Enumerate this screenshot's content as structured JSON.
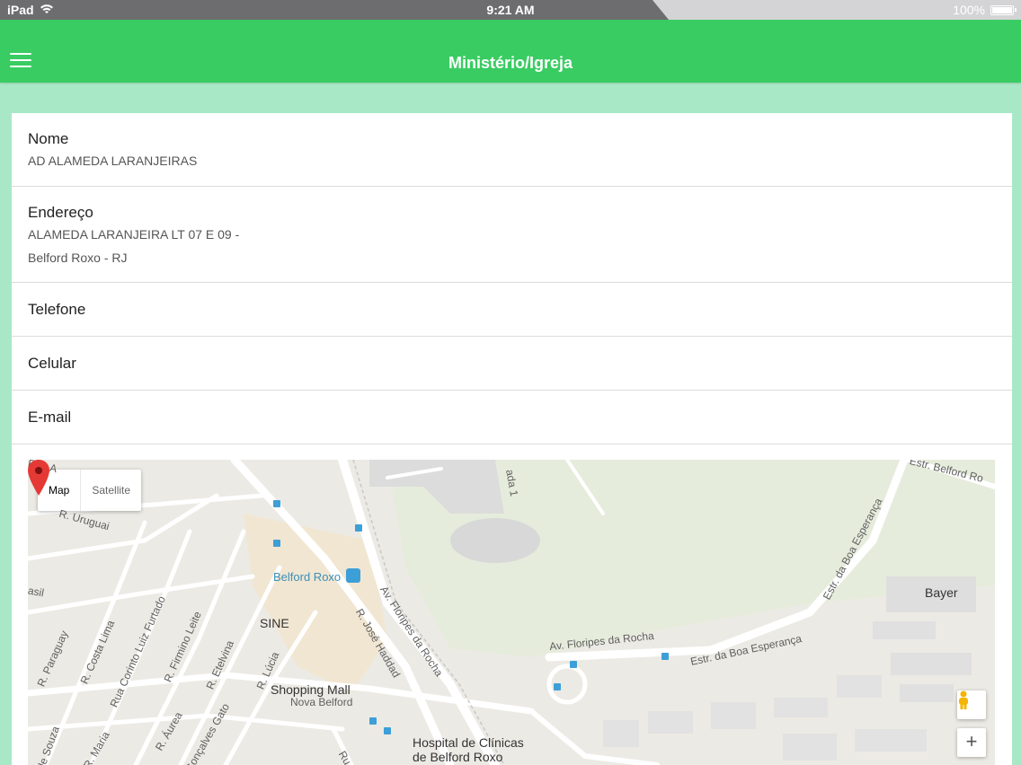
{
  "status_bar": {
    "device": "iPad",
    "time": "9:21 AM",
    "battery": "100%"
  },
  "header": {
    "title": "Ministério/Igreja",
    "menu_icon": "hamburger-menu-icon"
  },
  "fields": {
    "nome": {
      "label": "Nome",
      "value": "AD ALAMEDA LARANJEIRAS"
    },
    "endereco": {
      "label": "Endereço",
      "line1": "ALAMEDA LARANJEIRA LT 07 E 09 -",
      "line2": "Belford Roxo - RJ"
    },
    "telefone": {
      "label": "Telefone"
    },
    "celular": {
      "label": "Celular"
    },
    "email": {
      "label": "E-mail"
    }
  },
  "map": {
    "type_buttons": {
      "map": "Map",
      "satellite": "Satellite"
    },
    "zoom_in": "+",
    "labels": {
      "belford_roxo": "Belford Roxo",
      "sine": "SINE",
      "shopping_mall": "Shopping Mall",
      "nova_belford": "Nova Belford",
      "hospital_1": "Hospital de Clínicas",
      "hospital_2": "de Belford Roxo",
      "bayer": "Bayer",
      "av_floripes_1": "Av. Floripes da Rocha",
      "av_floripes_2": "Av. Floripes da Rocha",
      "r_jose_haddad": "R. José Haddad",
      "estr_boa_esperanca_1": "Estr. da Boa Esperança",
      "estr_boa_esperanca_2": "Estr. da Boa Esperança",
      "estr_belford_roxo": "Estr. Belford Ro",
      "r_uruguai": "R. Uruguai",
      "r_paraguay": "R. Paraguay",
      "r_costa_lima": "R. Costa Lima",
      "r_corinto": "Rua Corinto Luiz Furtado",
      "r_firmino": "R. Firmino Leite",
      "r_etelvina": "R. Etelvina",
      "r_lucia": "R. Lúcia",
      "r_aurea": "R. Áurea",
      "r_maria": "R. Maria",
      "goncalves_gato": "Gonçalves Gato",
      "de_souza": "de Souza",
      "brasil": "asil",
      "rua_a": "Rua A",
      "ada_1": "ada 1",
      "rua": "Ru"
    },
    "colors": {
      "road": "#ffffff",
      "land": "#eceae4",
      "park": "#e4ebd9",
      "commercial": "#f3e8d6",
      "marker": "#e53935"
    }
  }
}
